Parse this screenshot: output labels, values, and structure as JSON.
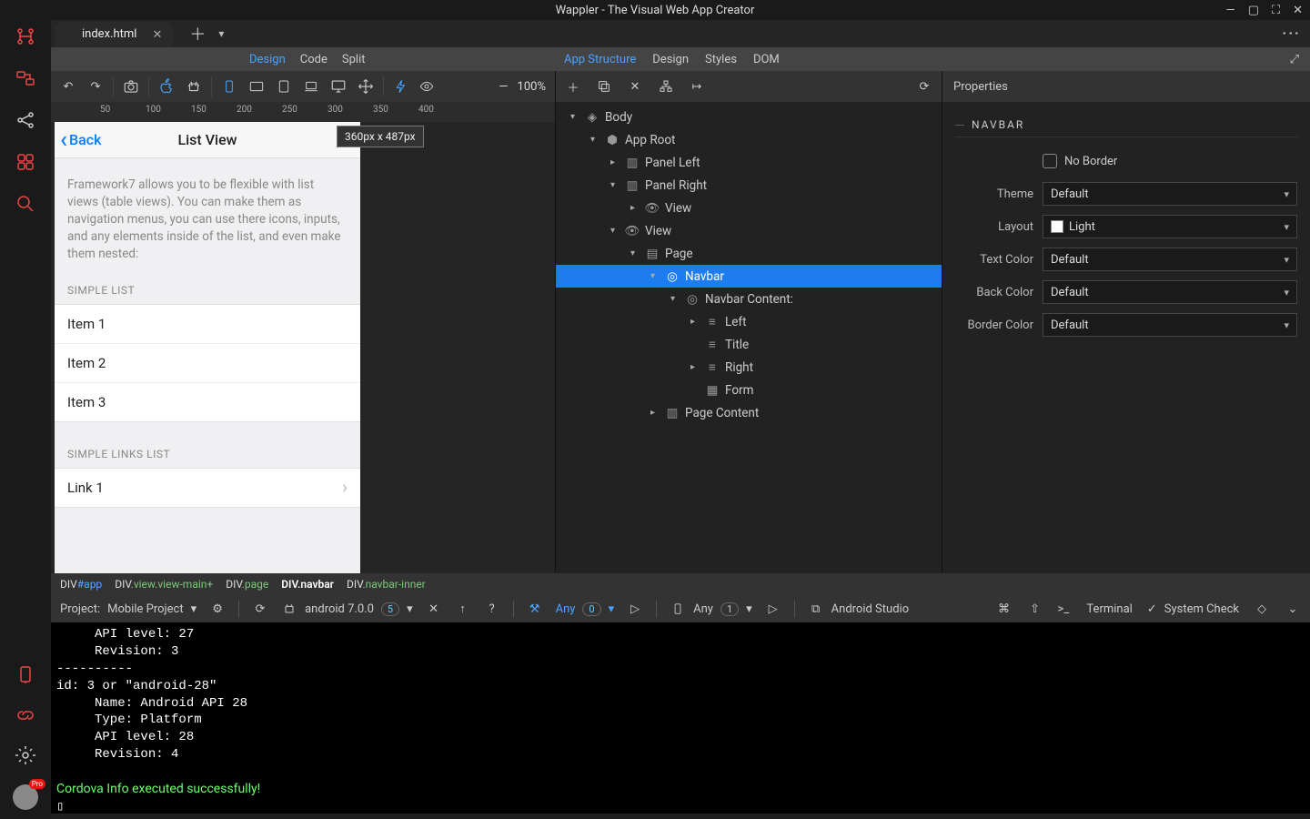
{
  "app": {
    "title": "Wappler - The Visual Web App Creator"
  },
  "tabs": {
    "file": "index.html"
  },
  "modes": {
    "left": [
      "Design",
      "Code",
      "Split"
    ],
    "center": [
      "App Structure",
      "Design",
      "Styles",
      "DOM"
    ],
    "active_left": "Design",
    "active_center": "App Structure"
  },
  "zoom": {
    "value": "100%"
  },
  "ruler": {
    "marks": [
      "50",
      "100",
      "150",
      "200",
      "250",
      "300",
      "350",
      "400"
    ]
  },
  "size_badge": "360px x 487px",
  "preview": {
    "back": "Back",
    "title": "List View",
    "intro": "Framework7 allows you to be flexible with list views (table views). You can make them as navigation menus, you can use there icons, inputs, and any elements inside of the list, and even make them nested:",
    "section1": "SIMPLE LIST",
    "items1": [
      "Item 1",
      "Item 2",
      "Item 3"
    ],
    "section2": "SIMPLE LINKS LIST",
    "links2": [
      "Link 1"
    ]
  },
  "breadcrumb": [
    {
      "pre": "DIV",
      "cls": "#app",
      "type": "id"
    },
    {
      "pre": "DIV",
      "cls": ".view.view-main+",
      "type": "cls"
    },
    {
      "pre": "DIV",
      "cls": ".page",
      "type": "cls"
    },
    {
      "pre": "DIV",
      "cls": ".navbar",
      "type": "active"
    },
    {
      "pre": "DIV",
      "cls": ".navbar-inner",
      "type": "cls"
    }
  ],
  "tree": [
    {
      "depth": 0,
      "tw": "▾",
      "icon": "cube",
      "label": "Body"
    },
    {
      "depth": 1,
      "tw": "▾",
      "icon": "cube3d",
      "label": "App Root"
    },
    {
      "depth": 2,
      "tw": "▸",
      "icon": "panel",
      "label": "Panel Left"
    },
    {
      "depth": 2,
      "tw": "▾",
      "icon": "panel",
      "label": "Panel Right"
    },
    {
      "depth": 3,
      "tw": "▸",
      "icon": "eye",
      "label": "View"
    },
    {
      "depth": 2,
      "tw": "▾",
      "icon": "eye",
      "label": "View"
    },
    {
      "depth": 3,
      "tw": "▾",
      "icon": "page",
      "label": "Page"
    },
    {
      "depth": 4,
      "tw": "▾",
      "icon": "compass",
      "label": "Navbar",
      "sel": true
    },
    {
      "depth": 5,
      "tw": "▾",
      "icon": "compass",
      "label": "Navbar Content:"
    },
    {
      "depth": 6,
      "tw": "▸",
      "icon": "align",
      "label": "Left"
    },
    {
      "depth": 6,
      "tw": "",
      "icon": "align",
      "label": "Title"
    },
    {
      "depth": 6,
      "tw": "▸",
      "icon": "align",
      "label": "Right"
    },
    {
      "depth": 6,
      "tw": "",
      "icon": "form",
      "label": "Form"
    },
    {
      "depth": 4,
      "tw": "▸",
      "icon": "pagec",
      "label": "Page Content"
    }
  ],
  "props": {
    "header": "Properties",
    "section": "NAVBAR",
    "noborder_label": "No Border",
    "rows": {
      "theme": {
        "label": "Theme",
        "value": "Default"
      },
      "layout": {
        "label": "Layout",
        "value": "Light",
        "swatch": true
      },
      "textcolor": {
        "label": "Text Color",
        "value": "Default"
      },
      "backcolor": {
        "label": "Back Color",
        "value": "Default"
      },
      "bordercolor": {
        "label": "Border Color",
        "value": "Default"
      }
    }
  },
  "status": {
    "project_label": "Project:",
    "project_name": "Mobile Project",
    "platform": "android 7.0.0",
    "platform_count": "5",
    "run": "Any",
    "run_count": "0",
    "device": "Any",
    "device_count": "1",
    "studio": "Android Studio",
    "terminal": "Terminal",
    "syscheck": "System Check"
  },
  "terminal_lines": [
    "     API level: 27",
    "     Revision: 3",
    "----------",
    "id: 3 or \"android-28\"",
    "     Name: Android API 28",
    "     Type: Platform",
    "     API level: 28",
    "     Revision: 4",
    "",
    "Cordova Info executed successfully!",
    "▯"
  ]
}
